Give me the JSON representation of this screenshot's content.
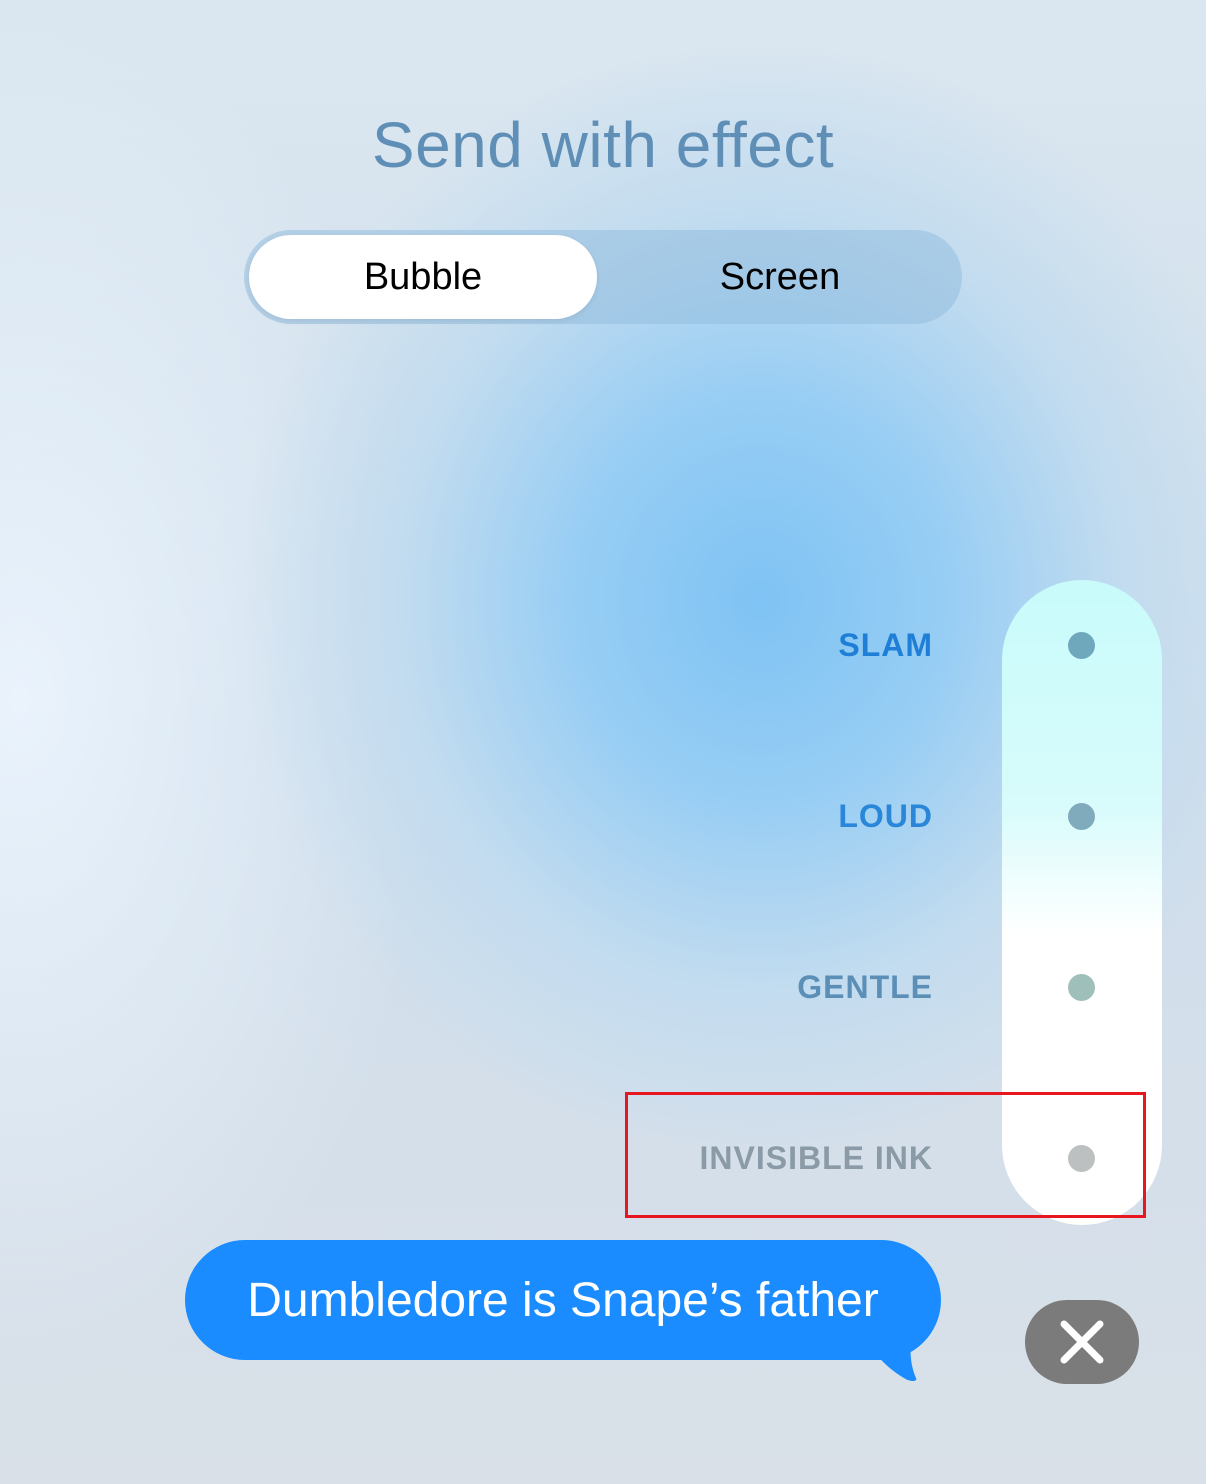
{
  "header": {
    "title": "Send with effect"
  },
  "segments": {
    "bubble_label": "Bubble",
    "screen_label": "Screen",
    "selected": "Bubble"
  },
  "effects": [
    {
      "label": "SLAM",
      "color": "#1f7fd6"
    },
    {
      "label": "LOUD",
      "color": "#2a86d8"
    },
    {
      "label": "GENTLE",
      "color": "#5b8fb8"
    },
    {
      "label": "INVISIBLE INK",
      "color": "#8a9aa6"
    }
  ],
  "dots": {
    "slam": "#6fa7bd",
    "loud": "#80abbd",
    "gentle": "#9fbfbb",
    "invisible_ink": "#bcc0c0"
  },
  "message": {
    "text": "Dumbledore is Snape’s father",
    "bubble_color": "#1a8cff"
  },
  "highlight_color": "#e8161f",
  "icons": {
    "close": "close-icon"
  }
}
